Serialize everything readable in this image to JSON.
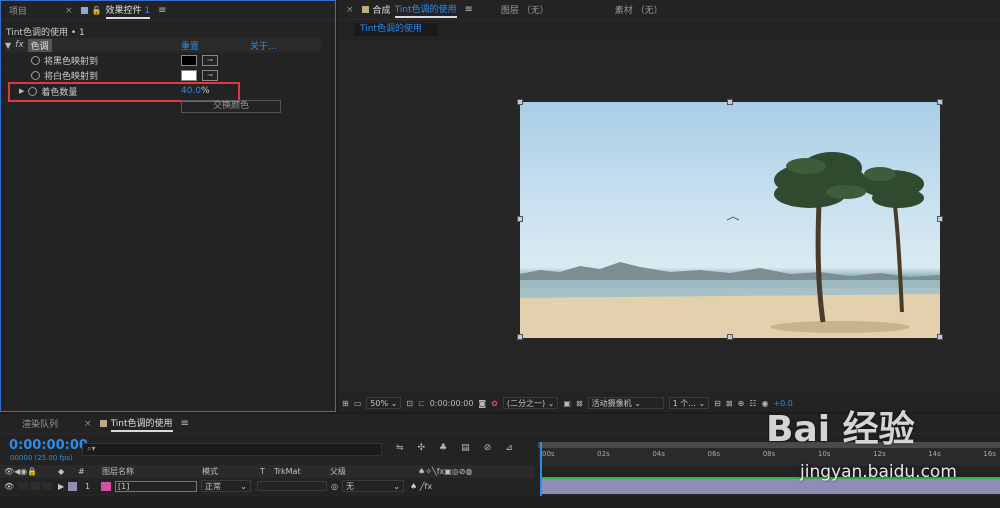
{
  "project_panel": {
    "tab_project": "项目",
    "tab_effects_label": "效果控件",
    "tab_effects_layer": "1",
    "breadcrumb": "Tint色调的使用 • 1"
  },
  "effect": {
    "fx": "fx",
    "name": "色调",
    "reset": "重置",
    "about": "关于...",
    "props": [
      {
        "label": "将黑色映射到",
        "color": "#000000"
      },
      {
        "label": "将白色映射到",
        "color": "#ffffff"
      }
    ],
    "amount": {
      "label": "着色数量",
      "value": "40.0",
      "unit": "%"
    },
    "swap_button": "交换颜色"
  },
  "comp_panel": {
    "tab_prefix": "合成",
    "tab_comp": "Tint色调的使用",
    "tab_layer": "图层 （无）",
    "tab_footage": "素材 （无）",
    "subtab": "Tint色调的使用"
  },
  "comp_toolbar": {
    "zoom": "50%",
    "timecode": "0:00:00:00",
    "resolution": "(二分之一)",
    "camera": "活动摄像机",
    "views": "1 个...",
    "exposure": "+0.0"
  },
  "timeline": {
    "tab_render": "渲染队列",
    "tab_comp": "Tint色调的使用",
    "timecode": "0:00:00:00",
    "frames": "00000 (25.00 fps)",
    "search_placeholder": "",
    "headers": {
      "num": "#",
      "layer_name": "图层名称",
      "mode": "模式",
      "t": "T",
      "trkmat": "TrkMat",
      "parent": "父级"
    },
    "layer": {
      "num": "1",
      "name": "[1]",
      "mode": "正常",
      "parent": "无"
    },
    "ruler": [
      "00s",
      "02s",
      "04s",
      "06s",
      "08s",
      "10s",
      "12s",
      "14s",
      "16s"
    ]
  },
  "watermark": {
    "brand": "Bai 经验",
    "url": "jingyan.baidu.com"
  },
  "colors": {
    "accent_blue": "#2d8ceb",
    "highlight_red": "#e0393e",
    "bar_green": "#2fb34b",
    "layer_purple": "#8d8db8"
  }
}
